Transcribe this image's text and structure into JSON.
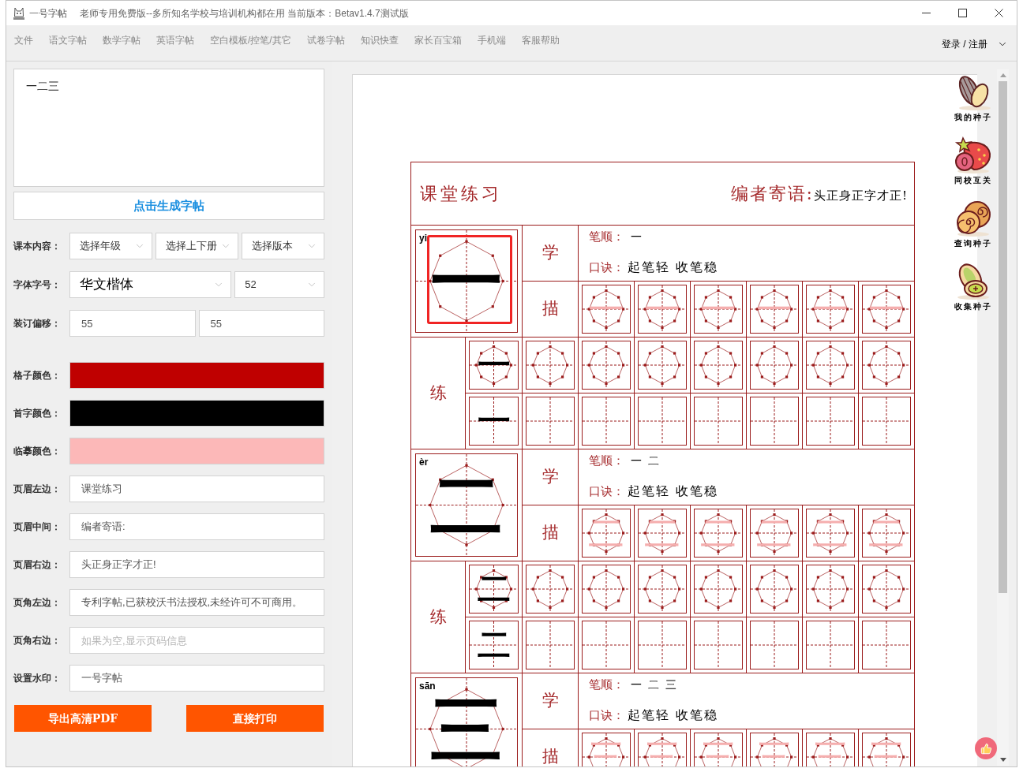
{
  "window": {
    "title": "一号字帖",
    "subtitle": "老师专用免费版--多所知名学校与培训机构都在用 当前版本：Betav1.4.7测试版"
  },
  "menu": [
    {
      "label": "文件"
    },
    {
      "label": "语文字帖"
    },
    {
      "label": "数学字帖"
    },
    {
      "label": "英语字帖"
    },
    {
      "label": "空白模板/控笔/其它"
    },
    {
      "label": "试卷字帖"
    },
    {
      "label": "知识快查"
    },
    {
      "label": "家长百宝箱"
    },
    {
      "label": "手机端"
    },
    {
      "label": "客服帮助"
    }
  ],
  "account": {
    "label": "登录 / 注册"
  },
  "editor": {
    "text": "一二三",
    "generate_button": "点击生成字帖",
    "sections": [
      {
        "rows": [
          {
            "label": "课本内容：",
            "fields": [
              {
                "kind": "select",
                "value": "选择年级"
              },
              {
                "kind": "select",
                "value": "选择上下册"
              },
              {
                "kind": "select",
                "value": "选择版本"
              }
            ]
          },
          {
            "label": "字体字号：",
            "fields": [
              {
                "kind": "font_select",
                "value": "华文楷体"
              },
              {
                "kind": "select",
                "value": "52"
              }
            ]
          },
          {
            "label": "装订偏移：",
            "fields": [
              {
                "kind": "input",
                "value": "55"
              },
              {
                "kind": "input",
                "value": "55"
              }
            ]
          }
        ]
      },
      {
        "rows": [
          {
            "label": "格子颜色：",
            "fields": [
              {
                "kind": "color",
                "color": "#bf0000"
              }
            ]
          },
          {
            "label": "首字颜色：",
            "fields": [
              {
                "kind": "color",
                "color": "#000000"
              }
            ]
          },
          {
            "label": "临摹颜色：",
            "fields": [
              {
                "kind": "color",
                "color": "#fcb8b8"
              }
            ]
          },
          {
            "label": "页眉左边：",
            "fields": [
              {
                "kind": "input",
                "value": "课堂练习"
              }
            ]
          },
          {
            "label": "页眉中间：",
            "fields": [
              {
                "kind": "input",
                "value": "编者寄语:"
              }
            ]
          },
          {
            "label": "页眉右边：",
            "fields": [
              {
                "kind": "input",
                "value": "头正身正字才正!"
              }
            ]
          },
          {
            "label": "页角左边：",
            "fields": [
              {
                "kind": "input",
                "value": "专利字帖,已获校沃书法授权,未经许可不可商用。"
              }
            ]
          },
          {
            "label": "页角右边：",
            "fields": [
              {
                "kind": "input",
                "placeholder": "如果为空,显示页码信息"
              }
            ]
          },
          {
            "label": "设置水印：",
            "fields": [
              {
                "kind": "input",
                "value": "一号字帖"
              }
            ]
          }
        ]
      }
    ],
    "buttons": [
      {
        "label": "导出高清PDF"
      },
      {
        "label": "直接打印"
      }
    ]
  },
  "sheet": {
    "header": {
      "left": "课堂练习",
      "middle": "编者寄语:",
      "right": "头正身正字才正!"
    },
    "blocks": [
      {
        "pinyin": "yi",
        "character": "一",
        "highlighted": true,
        "learn_label": "学",
        "stroke_order_label": "笔顺：",
        "stroke_steps": [
          "一"
        ],
        "mnemonic_label": "口诀：",
        "mnemonic": "起笔轻 收笔稳",
        "trace_label": "描",
        "trace": [
          "一",
          "一",
          "一",
          "一",
          "一",
          "一"
        ],
        "practice_label": "练",
        "practice_rows": [
          {
            "kind": "octagon",
            "model": "一"
          },
          {
            "kind": "plain",
            "model": "一"
          }
        ]
      },
      {
        "pinyin": "èr",
        "character": "二",
        "highlighted": false,
        "learn_label": "学",
        "stroke_order_label": "笔顺：",
        "stroke_steps": [
          "一",
          "二"
        ],
        "mnemonic_label": "口诀：",
        "mnemonic": "起笔轻 收笔稳",
        "trace_label": "描",
        "trace": [
          "二",
          "二",
          "二",
          "二",
          "二",
          "二"
        ],
        "practice_label": "练",
        "practice_rows": [
          {
            "kind": "octagon",
            "model": "二"
          },
          {
            "kind": "plain",
            "model": "二"
          }
        ]
      },
      {
        "pinyin": "sān",
        "character": "三",
        "highlighted": false,
        "learn_label": "学",
        "stroke_order_label": "笔顺：",
        "stroke_steps": [
          "一",
          "二",
          "三"
        ],
        "mnemonic_label": "口诀：",
        "mnemonic": "起笔轻 收笔稳",
        "trace_label": "描",
        "trace": [
          "三",
          "三",
          "三",
          "三",
          "三",
          "三"
        ]
      }
    ]
  },
  "tools": [
    {
      "label": "我的种子"
    },
    {
      "label": "同校互关"
    },
    {
      "label": "查询种子"
    },
    {
      "label": "收集种子"
    }
  ]
}
